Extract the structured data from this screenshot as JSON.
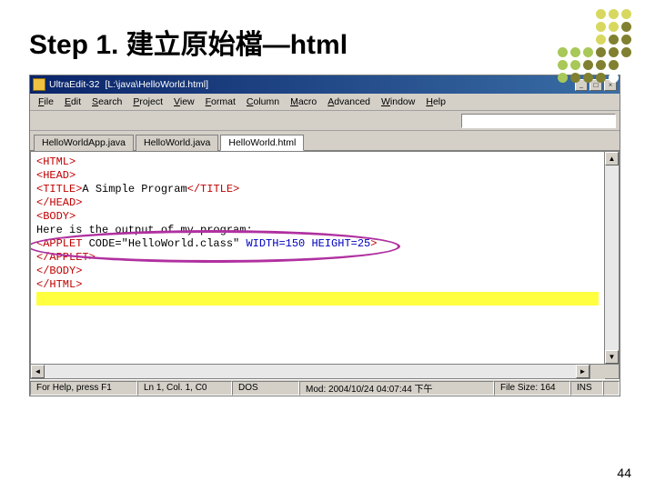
{
  "slide": {
    "title": "Step 1. 建立原始檔—html",
    "page_num": "44"
  },
  "window": {
    "app_name": "UltraEdit-32",
    "doc_path": "[L:\\java\\HelloWorld.html]",
    "btn_min": "_",
    "btn_max": "□",
    "btn_close": "×"
  },
  "menu": {
    "file": "File",
    "edit": "Edit",
    "search": "Search",
    "project": "Project",
    "view": "View",
    "format": "Format",
    "column": "Column",
    "macro": "Macro",
    "advanced": "Advanced",
    "window": "Window",
    "help": "Help"
  },
  "tabs": {
    "t1": "HelloWorldApp.java",
    "t2": "HelloWorld.java",
    "t3": "HelloWorld.html"
  },
  "code": {
    "l1a": "<HTML>",
    "l2a": "<HEAD>",
    "l3a": "<TITLE>",
    "l3b": "A Simple Program",
    "l3c": "</TITLE>",
    "l4a": "</HEAD>",
    "l5a": "<BODY>",
    "l6a": "Here is the output of my program:",
    "l7a": "<APPLET ",
    "l7b": "CODE=\"HelloWorld.class\" ",
    "l7c": "WIDTH=150 HEIGHT=25",
    "l7d": ">",
    "l8a": "</APPLET>",
    "l9a": "</BODY>",
    "l10a": "</HTML>"
  },
  "status": {
    "help": "For Help, press F1",
    "pos": "Ln 1, Col. 1, C0",
    "enc": "DOS",
    "mod": "Mod: 2004/10/24 04:07:44 下午",
    "size": "File Size: 164",
    "ins": "INS"
  },
  "dot_colors": [
    "#ffffff",
    "#ffffff",
    "#ffffff",
    "#d8d860",
    "#d8d860",
    "#d8d860",
    "#ffffff",
    "#ffffff",
    "#ffffff",
    "#d8d860",
    "#d8d860",
    "#808030",
    "#ffffff",
    "#ffffff",
    "#ffffff",
    "#d8d860",
    "#808030",
    "#808030",
    "#a8c858",
    "#a8c858",
    "#a8c858",
    "#808030",
    "#808030",
    "#808030",
    "#a8c858",
    "#a8c858",
    "#808030",
    "#808030",
    "#808030",
    "#ffffff",
    "#a8c858",
    "#808030",
    "#808030",
    "#808030",
    "#ffffff",
    "#ffffff"
  ]
}
